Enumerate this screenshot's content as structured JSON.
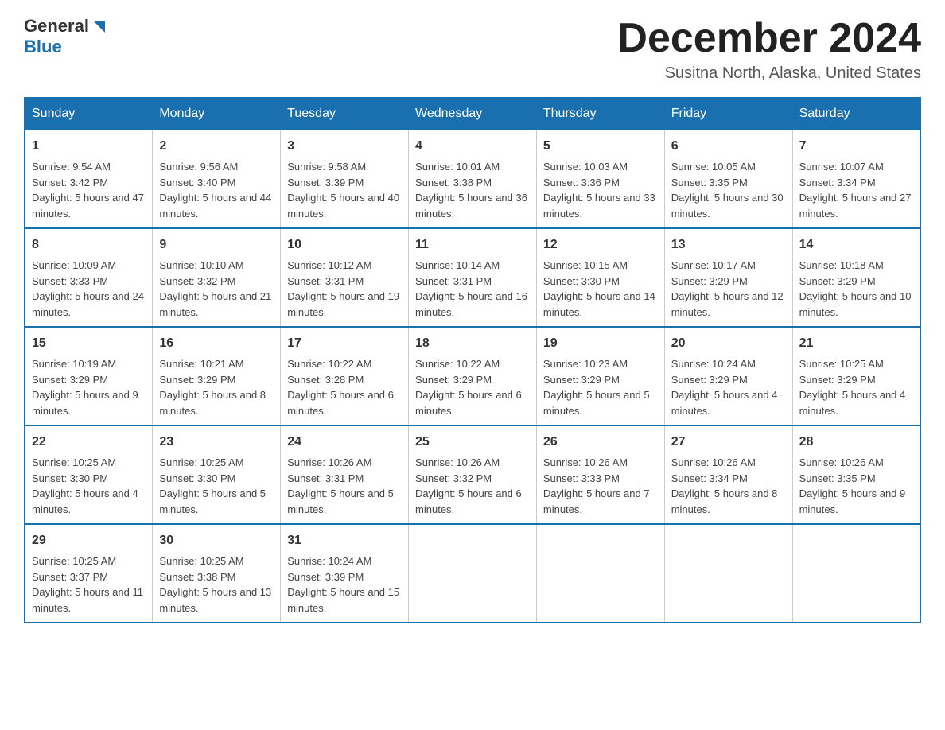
{
  "header": {
    "logo_general": "General",
    "logo_blue": "Blue",
    "month_title": "December 2024",
    "location": "Susitna North, Alaska, United States"
  },
  "days_of_week": [
    "Sunday",
    "Monday",
    "Tuesday",
    "Wednesday",
    "Thursday",
    "Friday",
    "Saturday"
  ],
  "weeks": [
    [
      {
        "day": "1",
        "sunrise": "9:54 AM",
        "sunset": "3:42 PM",
        "daylight": "5 hours and 47 minutes."
      },
      {
        "day": "2",
        "sunrise": "9:56 AM",
        "sunset": "3:40 PM",
        "daylight": "5 hours and 44 minutes."
      },
      {
        "day": "3",
        "sunrise": "9:58 AM",
        "sunset": "3:39 PM",
        "daylight": "5 hours and 40 minutes."
      },
      {
        "day": "4",
        "sunrise": "10:01 AM",
        "sunset": "3:38 PM",
        "daylight": "5 hours and 36 minutes."
      },
      {
        "day": "5",
        "sunrise": "10:03 AM",
        "sunset": "3:36 PM",
        "daylight": "5 hours and 33 minutes."
      },
      {
        "day": "6",
        "sunrise": "10:05 AM",
        "sunset": "3:35 PM",
        "daylight": "5 hours and 30 minutes."
      },
      {
        "day": "7",
        "sunrise": "10:07 AM",
        "sunset": "3:34 PM",
        "daylight": "5 hours and 27 minutes."
      }
    ],
    [
      {
        "day": "8",
        "sunrise": "10:09 AM",
        "sunset": "3:33 PM",
        "daylight": "5 hours and 24 minutes."
      },
      {
        "day": "9",
        "sunrise": "10:10 AM",
        "sunset": "3:32 PM",
        "daylight": "5 hours and 21 minutes."
      },
      {
        "day": "10",
        "sunrise": "10:12 AM",
        "sunset": "3:31 PM",
        "daylight": "5 hours and 19 minutes."
      },
      {
        "day": "11",
        "sunrise": "10:14 AM",
        "sunset": "3:31 PM",
        "daylight": "5 hours and 16 minutes."
      },
      {
        "day": "12",
        "sunrise": "10:15 AM",
        "sunset": "3:30 PM",
        "daylight": "5 hours and 14 minutes."
      },
      {
        "day": "13",
        "sunrise": "10:17 AM",
        "sunset": "3:29 PM",
        "daylight": "5 hours and 12 minutes."
      },
      {
        "day": "14",
        "sunrise": "10:18 AM",
        "sunset": "3:29 PM",
        "daylight": "5 hours and 10 minutes."
      }
    ],
    [
      {
        "day": "15",
        "sunrise": "10:19 AM",
        "sunset": "3:29 PM",
        "daylight": "5 hours and 9 minutes."
      },
      {
        "day": "16",
        "sunrise": "10:21 AM",
        "sunset": "3:29 PM",
        "daylight": "5 hours and 8 minutes."
      },
      {
        "day": "17",
        "sunrise": "10:22 AM",
        "sunset": "3:28 PM",
        "daylight": "5 hours and 6 minutes."
      },
      {
        "day": "18",
        "sunrise": "10:22 AM",
        "sunset": "3:29 PM",
        "daylight": "5 hours and 6 minutes."
      },
      {
        "day": "19",
        "sunrise": "10:23 AM",
        "sunset": "3:29 PM",
        "daylight": "5 hours and 5 minutes."
      },
      {
        "day": "20",
        "sunrise": "10:24 AM",
        "sunset": "3:29 PM",
        "daylight": "5 hours and 4 minutes."
      },
      {
        "day": "21",
        "sunrise": "10:25 AM",
        "sunset": "3:29 PM",
        "daylight": "5 hours and 4 minutes."
      }
    ],
    [
      {
        "day": "22",
        "sunrise": "10:25 AM",
        "sunset": "3:30 PM",
        "daylight": "5 hours and 4 minutes."
      },
      {
        "day": "23",
        "sunrise": "10:25 AM",
        "sunset": "3:30 PM",
        "daylight": "5 hours and 5 minutes."
      },
      {
        "day": "24",
        "sunrise": "10:26 AM",
        "sunset": "3:31 PM",
        "daylight": "5 hours and 5 minutes."
      },
      {
        "day": "25",
        "sunrise": "10:26 AM",
        "sunset": "3:32 PM",
        "daylight": "5 hours and 6 minutes."
      },
      {
        "day": "26",
        "sunrise": "10:26 AM",
        "sunset": "3:33 PM",
        "daylight": "5 hours and 7 minutes."
      },
      {
        "day": "27",
        "sunrise": "10:26 AM",
        "sunset": "3:34 PM",
        "daylight": "5 hours and 8 minutes."
      },
      {
        "day": "28",
        "sunrise": "10:26 AM",
        "sunset": "3:35 PM",
        "daylight": "5 hours and 9 minutes."
      }
    ],
    [
      {
        "day": "29",
        "sunrise": "10:25 AM",
        "sunset": "3:37 PM",
        "daylight": "5 hours and 11 minutes."
      },
      {
        "day": "30",
        "sunrise": "10:25 AM",
        "sunset": "3:38 PM",
        "daylight": "5 hours and 13 minutes."
      },
      {
        "day": "31",
        "sunrise": "10:24 AM",
        "sunset": "3:39 PM",
        "daylight": "5 hours and 15 minutes."
      },
      null,
      null,
      null,
      null
    ]
  ],
  "labels": {
    "sunrise_prefix": "Sunrise: ",
    "sunset_prefix": "Sunset: ",
    "daylight_prefix": "Daylight: "
  }
}
